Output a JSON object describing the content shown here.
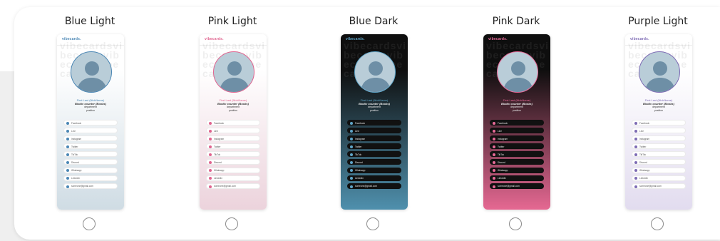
{
  "themes": [
    {
      "title": "Blue Light",
      "brand": "vibecards.",
      "profile": {
        "name": "First Last (NickName)",
        "subtitle": "Biodiv counter (Books)",
        "department": "department",
        "position": "position"
      },
      "links": [
        "Facebook",
        "Line",
        "Instagram",
        "Twitter",
        "TikTok",
        "Discord",
        "Whatsapp",
        "LinkedIn",
        "someone@gmail.com"
      ],
      "colors": {
        "bg_top": "#ffffff",
        "bg_bottom": "#cfdce4",
        "text": "#333333",
        "accent": "#4a86b4",
        "pill": "#ffffff",
        "pill_text": "#555555",
        "brand": "#4a86b4"
      }
    },
    {
      "title": "Pink Light",
      "brand": "vibecards.",
      "profile": {
        "name": "First Last (NickName)",
        "subtitle": "Biodiv counter (Books)",
        "department": "department",
        "position": "position"
      },
      "links": [
        "Facebook",
        "Line",
        "Instagram",
        "Twitter",
        "TikTok",
        "Discord",
        "Whatsapp",
        "LinkedIn",
        "someone@gmail.com"
      ],
      "colors": {
        "bg_top": "#ffffff",
        "bg_bottom": "#ecd3dc",
        "text": "#333333",
        "accent": "#e0648f",
        "pill": "#ffffff",
        "pill_text": "#555555",
        "brand": "#e0648f"
      }
    },
    {
      "title": "Blue Dark",
      "brand": "vibecards.",
      "profile": {
        "name": "First Last (NickName)",
        "subtitle": "Biodiv counter (Books)",
        "department": "department",
        "position": "position"
      },
      "links": [
        "Facebook",
        "Line",
        "Instagram",
        "Twitter",
        "TikTok",
        "Discord",
        "Whatsapp",
        "LinkedIn",
        "someone@gmail.com"
      ],
      "colors": {
        "bg_top": "#0e0e0e",
        "bg_bottom": "#4f90ad",
        "text": "#eeeeee",
        "accent": "#5fa5c8",
        "pill": "#111111",
        "pill_text": "#e5e5e5",
        "brand": "#5fa5c8"
      }
    },
    {
      "title": "Pink Dark",
      "brand": "vibecards.",
      "profile": {
        "name": "First Last (NickName)",
        "subtitle": "Biodiv counter (Books)",
        "department": "department",
        "position": "position"
      },
      "links": [
        "Facebook",
        "Line",
        "Instagram",
        "Twitter",
        "TikTok",
        "Discord",
        "Whatsapp",
        "LinkedIn",
        "someone@gmail.com"
      ],
      "colors": {
        "bg_top": "#0e0e0e",
        "bg_bottom": "#e56892",
        "text": "#eeeeee",
        "accent": "#e86a98",
        "pill": "#111111",
        "pill_text": "#e5e5e5",
        "brand": "#e86a98"
      }
    },
    {
      "title": "Purple Light",
      "brand": "vibecards.",
      "profile": {
        "name": "First Last (NickName)",
        "subtitle": "Biodiv counter (Books)",
        "department": "department",
        "position": "position"
      },
      "links": [
        "Facebook",
        "Line",
        "Instagram",
        "Twitter",
        "TikTok",
        "Discord",
        "Whatsapp",
        "LinkedIn",
        "someone@gmail.com"
      ],
      "colors": {
        "bg_top": "#ffffff",
        "bg_bottom": "#e2dcef",
        "text": "#333333",
        "accent": "#7d6bb4",
        "pill": "#ffffff",
        "pill_text": "#555555",
        "brand": "#7d6bb4"
      }
    }
  ],
  "watermark_text": "vibecardsvibecardsvibecardsvibecards"
}
